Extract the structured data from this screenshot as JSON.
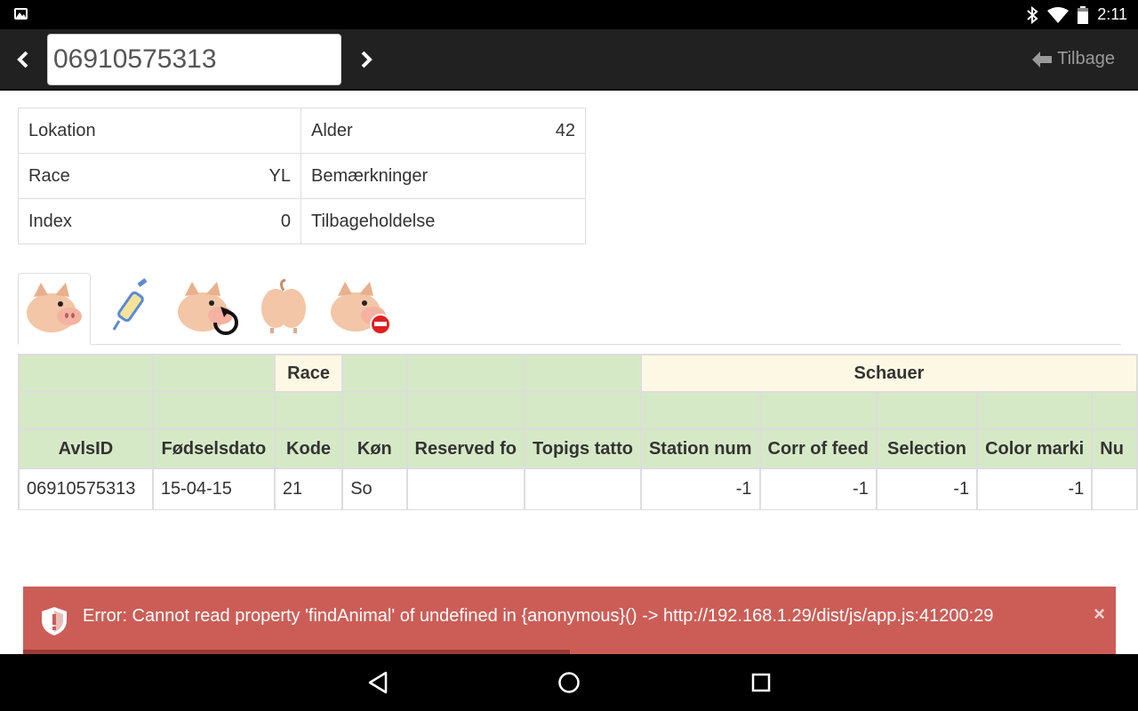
{
  "status_bar": {
    "time": "2:11"
  },
  "header": {
    "animal_id_value": "06910575313",
    "back_label": "Tilbage"
  },
  "info": {
    "rows": [
      {
        "left_label": "Lokation",
        "left_value": "",
        "right_label": "Alder",
        "right_value": "42"
      },
      {
        "left_label": "Race",
        "left_value": "YL",
        "right_label": "Bemærkninger",
        "right_value": ""
      },
      {
        "left_label": "Index",
        "left_value": "0",
        "right_label": "Tilbageholdelse",
        "right_value": ""
      }
    ]
  },
  "tabs": [
    {
      "icon": "pig-icon",
      "active": true
    },
    {
      "icon": "syringe-icon",
      "active": false
    },
    {
      "icon": "pig-refresh-icon",
      "active": false
    },
    {
      "icon": "pig-rear-icon",
      "active": false
    },
    {
      "icon": "pig-remove-icon",
      "active": false
    }
  ],
  "table": {
    "group_headers": {
      "race": "Race",
      "schauer": "Schauer"
    },
    "columns": [
      "AvlsID",
      "Fødselsdato",
      "Kode",
      "Køn",
      "Reserved fo",
      "Topigs tatto",
      "Station num",
      "Corr of feed",
      "Selection",
      "Color marki",
      "Nu"
    ],
    "rows": [
      [
        "06910575313",
        "15-04-15",
        "21",
        "So",
        "",
        "",
        "-1",
        "-1",
        "-1",
        "-1",
        ""
      ]
    ]
  },
  "toast": {
    "message": "Error: Cannot read property 'findAnimal' of undefined in {anonymous}() -> http://192.168.1.29/dist/js/app.js:41200:29",
    "close": "×",
    "progress_fraction": 0.5
  },
  "colors": {
    "header_green": "#d6e9c6",
    "header_beige": "#fcf8e3",
    "error_red": "#cc5d56",
    "topbar": "#212121"
  }
}
